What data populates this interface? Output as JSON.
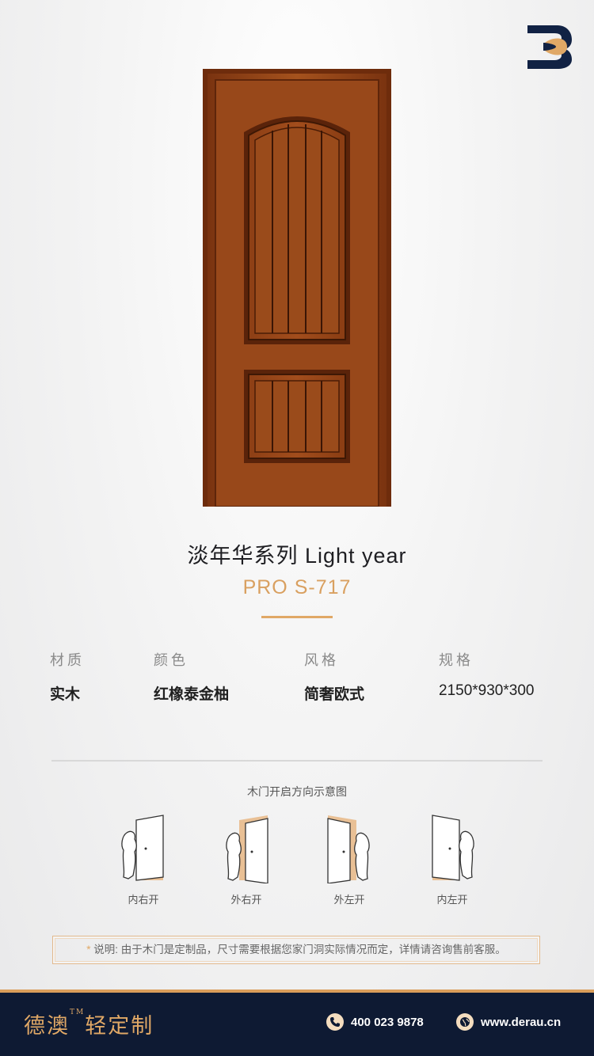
{
  "product": {
    "title": "淡年华系列  Light year",
    "model": "PRO S-717"
  },
  "specs": [
    {
      "label": "材质",
      "value": "实木"
    },
    {
      "label": "颜色",
      "value": "红橡泰金柚"
    },
    {
      "label": "风格",
      "value": "简奢欧式"
    },
    {
      "label": "规格",
      "value": "2150*930*300"
    }
  ],
  "opening": {
    "title": "木门开启方向示意图",
    "directions": [
      {
        "label": "内右开"
      },
      {
        "label": "外右开"
      },
      {
        "label": "外左开"
      },
      {
        "label": "内左开"
      }
    ]
  },
  "note": {
    "marker": "*",
    "text": "说明: 由于木门是定制品，尺寸需要根据您家门洞实际情况而定，详情请咨询售前客服。"
  },
  "footer": {
    "brand": "德澳",
    "trademark": "TM",
    "tagline": "轻定制",
    "phone": "400 023 9878",
    "website": "www.derau.cn",
    "icons": [
      "phone-icon",
      "globe-icon"
    ]
  },
  "colors": {
    "accent": "#e0a866",
    "footer_bg": "#0e1a33",
    "door_wood": "#8a3d13"
  }
}
